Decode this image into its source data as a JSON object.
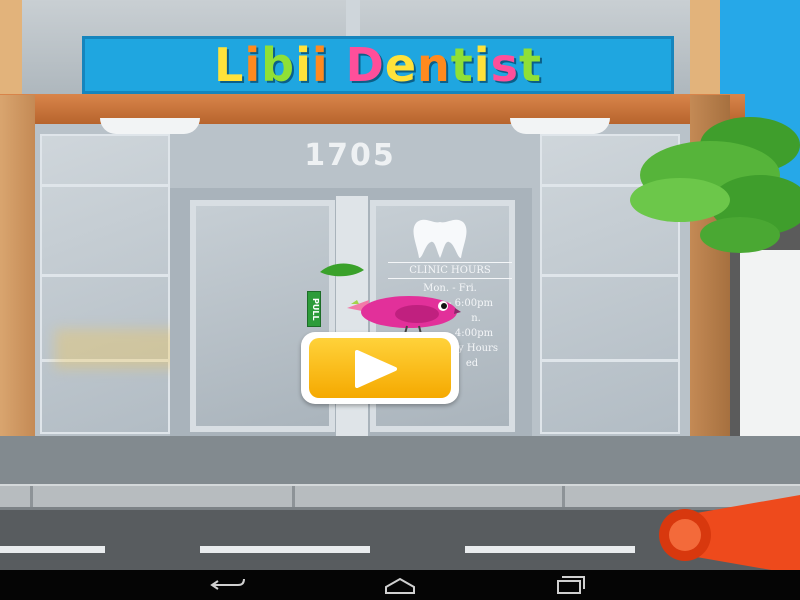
{
  "sign": {
    "letters": [
      {
        "ch": "L",
        "color": "#ffe23a"
      },
      {
        "ch": "i",
        "color": "#ff8a1e"
      },
      {
        "ch": "b",
        "color": "#8fe036"
      },
      {
        "ch": "i",
        "color": "#ffe23a"
      },
      {
        "ch": "i",
        "color": "#ff8a1e"
      },
      {
        "ch": " ",
        "color": "#ffffff"
      },
      {
        "ch": "D",
        "color": "#ff4f9a"
      },
      {
        "ch": "e",
        "color": "#ffe23a"
      },
      {
        "ch": "n",
        "color": "#ff8a1e"
      },
      {
        "ch": "t",
        "color": "#8fe036"
      },
      {
        "ch": "i",
        "color": "#ffe23a"
      },
      {
        "ch": "s",
        "color": "#ff4f9a"
      },
      {
        "ch": "t",
        "color": "#8fe036"
      }
    ]
  },
  "storefront": {
    "street_number": "1705",
    "pull_label": "PULL"
  },
  "clinic_hours": {
    "heading": "CLINIC HOURS",
    "lines": [
      "Mon. - Fri.",
      "9:00am - 6:00pm",
      "n.",
      "4:00pm",
      "y Hours",
      "ed"
    ]
  },
  "controls": {
    "play_icon": "play-triangle-icon",
    "megaphone_icon": "megaphone-icon"
  },
  "system_nav": {
    "back_icon": "back-icon",
    "home_icon": "home-icon",
    "recents_icon": "recents-icon"
  },
  "colors": {
    "sign_background": "#1fa6e0",
    "play_button": "#f5b800",
    "megaphone": "#ee4a1c",
    "bird": "#e2309a"
  }
}
